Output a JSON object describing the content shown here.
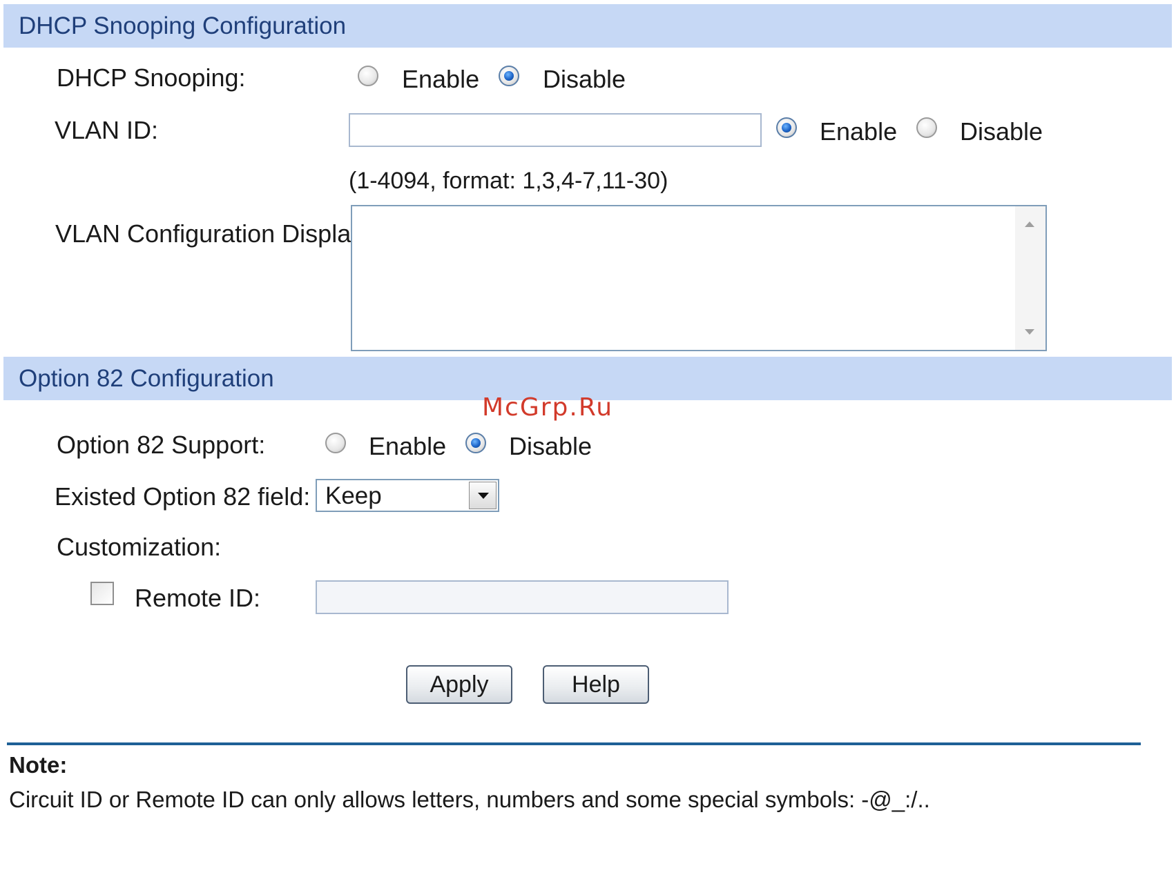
{
  "dhcp_section": {
    "title": "DHCP Snooping Configuration",
    "snooping_label": "DHCP Snooping:",
    "snooping_enable": "Enable",
    "snooping_disable": "Disable",
    "snooping_selected": "Disable",
    "vlan_label": "VLAN ID:",
    "vlan_value": "",
    "vlan_enable": "Enable",
    "vlan_disable": "Disable",
    "vlan_selected": "Enable",
    "vlan_hint": "(1-4094, format: 1,3,4-7,11-30)",
    "vlan_display_label": "VLAN Configuration Display:",
    "vlan_display_value": ""
  },
  "option82_section": {
    "title": "Option 82 Configuration",
    "support_label": "Option 82 Support:",
    "support_enable": "Enable",
    "support_disable": "Disable",
    "support_selected": "Disable",
    "existed_label": "Existed Option 82 field:",
    "existed_value": "Keep",
    "customization_label": "Customization:",
    "remote_id_label": "Remote ID:",
    "remote_id_checked": false,
    "remote_id_value": ""
  },
  "buttons": {
    "apply": "Apply",
    "help": "Help"
  },
  "note": {
    "heading": "Note:",
    "text": "Circuit ID or Remote ID can only allows letters, numbers and some special symbols: -@_:/.."
  },
  "watermark": "McGrp.Ru"
}
